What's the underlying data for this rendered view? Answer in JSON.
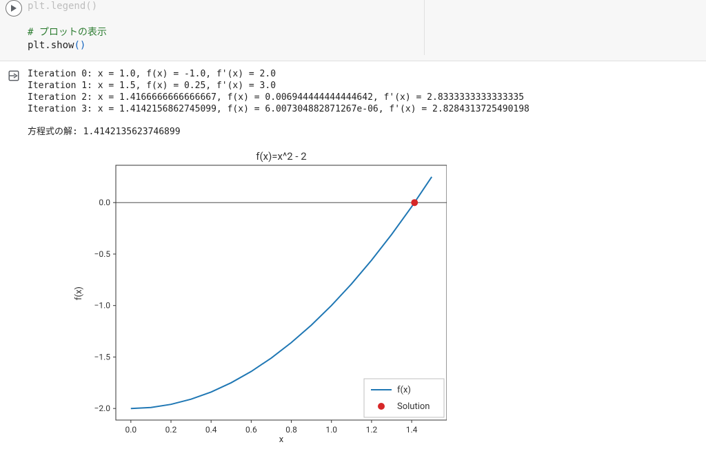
{
  "code": {
    "line0": "plt.legend()",
    "comment": "# プロットの表示",
    "line2a": "plt.show",
    "line2b": "()"
  },
  "output": {
    "iterations": [
      "Iteration 0: x = 1.0, f(x) = -1.0, f'(x) = 2.0",
      "Iteration 1: x = 1.5, f(x) = 0.25, f'(x) = 3.0",
      "Iteration 2: x = 1.4166666666666667, f(x) = 0.006944444444444642, f'(x) = 2.8333333333333335",
      "Iteration 3: x = 1.4142156862745099, f(x) = 6.007304882871267e-06, f'(x) = 2.8284313725490198"
    ],
    "solution": "方程式の解: 1.4142135623746899"
  },
  "chart_data": {
    "type": "line",
    "title": "f(x)=x^2 - 2",
    "xlabel": "x",
    "ylabel": "f(x)",
    "xlim": [
      0.0,
      1.5
    ],
    "ylim": [
      -2.0,
      0.25
    ],
    "xticks": [
      0.0,
      0.2,
      0.4,
      0.6,
      0.8,
      1.0,
      1.2,
      1.4
    ],
    "yticks": [
      -2.0,
      -1.5,
      -1.0,
      -0.5,
      0.0
    ],
    "series": [
      {
        "name": "f(x)",
        "type": "line",
        "color": "#1f77b4",
        "x": [
          0.0,
          0.1,
          0.2,
          0.3,
          0.4,
          0.5,
          0.6,
          0.7,
          0.8,
          0.9,
          1.0,
          1.1,
          1.2,
          1.3,
          1.4,
          1.5
        ],
        "y": [
          -2.0,
          -1.99,
          -1.96,
          -1.91,
          -1.84,
          -1.75,
          -1.64,
          -1.51,
          -1.36,
          -1.19,
          -1.0,
          -0.79,
          -0.56,
          -0.31,
          -0.04,
          0.25
        ]
      },
      {
        "name": "Solution",
        "type": "scatter",
        "color": "#d62728",
        "x": [
          1.4142135623746899
        ],
        "y": [
          0.0
        ]
      }
    ],
    "legend_labels": {
      "line": "f(x)",
      "point": "Solution"
    }
  }
}
